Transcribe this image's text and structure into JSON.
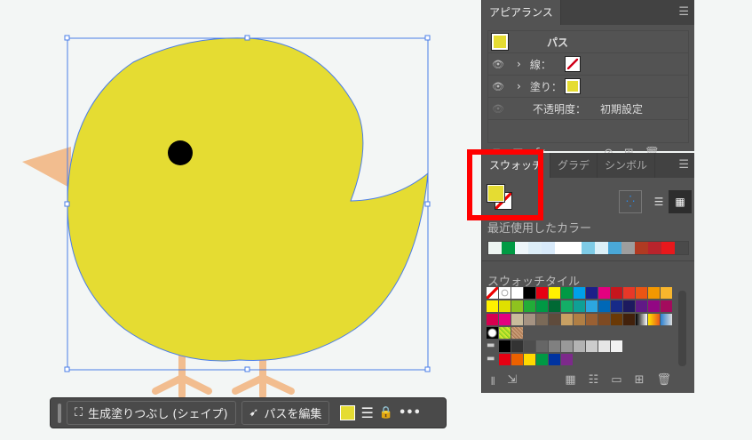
{
  "appearance": {
    "tab": "アピアランス",
    "object": "パス",
    "stroke_label": "線：",
    "fill_label": "塗り：",
    "opacity_label": "不透明度：",
    "opacity_value": "初期設定",
    "fx": "fx."
  },
  "swatches": {
    "tabs": [
      "スウォッチ",
      "グラデ",
      "シンボル"
    ],
    "recent_label": "最近使用したカラー",
    "recent": [
      "#eef5f2",
      "#009a44",
      "#eef6fa",
      "#ddeef8",
      "#d8eafa",
      "#ffffff",
      "#ffffff",
      "#7ecbe6",
      "#dcf0f8",
      "#4aa8d8",
      "#9e9e9e",
      "#b03a22",
      "#b8242c",
      "#e8181c",
      "#4a4a4a"
    ],
    "library_label": "スウォッチタイル",
    "rows": [
      [
        "none",
        "reg",
        "#ffffff",
        "#000000",
        "#e60012",
        "#fff100",
        "#009944",
        "#00a0e9",
        "#1d2088",
        "#e4007f",
        "#c7161d",
        "#e83828",
        "#ea5514",
        "#f39800",
        "#f8b62d"
      ],
      [
        "#fff100",
        "#dfe000",
        "#8fc31f",
        "#22ac38",
        "#009944",
        "#006934",
        "#13ae67",
        "#0fa096",
        "#2ca6e0",
        "#0068b7",
        "#172a88",
        "#1d1a5f",
        "#601986",
        "#920783",
        "#a40b5d"
      ],
      [
        "#d7004f",
        "#e4007f",
        "#c9bc9c",
        "#a59382",
        "#7b6a58",
        "#5f4b3c",
        "#c8a063",
        "#b07f45",
        "#9a6033",
        "#7e4a22",
        "#6a3906",
        "#42210b",
        "grad1",
        "grad2",
        "grad3"
      ],
      [
        "pat1",
        "pat2",
        "pat3"
      ],
      [
        "folder",
        "#000000",
        "#333333",
        "#4d4d4d",
        "#666666",
        "#808080",
        "#999999",
        "#b3b3b3",
        "#cccccc",
        "#e6e6e6",
        "#f2f2f2"
      ],
      [
        "folder",
        "#e60012",
        "#eb6100",
        "#ffd900",
        "#009944",
        "#0033a0",
        "#7d2a8b"
      ]
    ]
  },
  "toolbar": {
    "generative_fill": "生成塗りつぶし (シェイプ)",
    "edit_path": "パスを編集",
    "fill_color": "#e5dc32"
  },
  "colors": {
    "chick": "#e5dc32",
    "beak": "#f2bd8f",
    "selection": "#4a7de8"
  }
}
